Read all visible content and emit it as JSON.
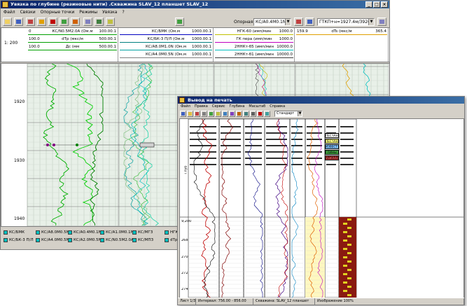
{
  "main": {
    "title": "Увязка по глубине (резиновые нити) .Скважина SLAV_12 планшет SLAV_12",
    "menu": [
      "Файл",
      "Связки",
      "Опорные точки",
      "Режимы",
      "Увязка",
      "?"
    ],
    "reference_label": "Опорная:",
    "reference_value": "КС/А0.4M0.1N",
    "right_field": "ГТКП+н=1927.4м/3920.0",
    "scale": "1: 200",
    "headers": [
      {
        "rows": [
          {
            "name": "КС/N0.5M2.0A (Ом.м",
            "min": "0",
            "max": "100.00.1",
            "color": "#00a000"
          },
          {
            "name": "dTp (мкс/м",
            "min": "100.0",
            "max": "500.00.1",
            "color": "#00a000"
          },
          {
            "name": "Дс (мм",
            "min": "100.0",
            "max": "500.00.1",
            "color": "#00a000"
          }
        ]
      },
      {
        "rows": [
          {
            "name": "КС/БМК (Ом.м",
            "min": "",
            "max": "1000.00.1",
            "color": "#0000c0"
          },
          {
            "name": "КС/БК-3 П/Л (Ом.м",
            "min": "",
            "max": "1000.00.1",
            "color": "#008080"
          },
          {
            "name": "КС/А8.0M1.0N (Ом.м",
            "min": "",
            "max": "1000.00.1",
            "color": "#00a0a0"
          },
          {
            "name": "КС/А4.0M0.5N (Ом.м",
            "min": "",
            "max": "1000.00.1",
            "color": "#808080"
          }
        ]
      },
      {
        "rows": [
          {
            "name": "НГК-60 (имп/мин",
            "min": "",
            "max": "1000.0",
            "color": "#c0c000"
          },
          {
            "name": "ГК пера (имп/мин",
            "min": "",
            "max": "1000.0",
            "color": "#c000c0"
          },
          {
            "name": "2ННКт-б5 (имп/мин",
            "min": "",
            "max": "10000.0",
            "color": "#00c0c0"
          },
          {
            "name": "2ННКт-б1 (имп/мин",
            "min": "",
            "max": "10000.0",
            "color": "#404040"
          }
        ]
      },
      {
        "rows": [
          {
            "name": "dTs (мкс/м",
            "min": "159.9",
            "max": "365.4",
            "color": "#e0a000"
          }
        ]
      }
    ],
    "depth_labels": [
      "1920",
      "1930",
      "1940"
    ],
    "marker_label": "",
    "legend": [
      {
        "label": "КС/БМК",
        "color": "#00c0c0"
      },
      {
        "label": "КС/БК-3 П/Л",
        "color": "#00c0c0"
      },
      {
        "label": "КС/А8.0M0.5N",
        "color": "#00c0c0"
      },
      {
        "label": "КС/А4.0M0.5N",
        "color": "#00c0c0"
      },
      {
        "label": "КС/А0.4M0.1N",
        "color": "#00c0c0"
      },
      {
        "label": "КС/А2.0M0.5N",
        "color": "#00c0c0"
      },
      {
        "label": "КС/А1.0M0.1N",
        "color": "#00c0c0"
      },
      {
        "label": "КС/N0.5M2.0A",
        "color": "#00c0c0"
      },
      {
        "label": "КС/МГЗ",
        "color": "#00c0c0"
      },
      {
        "label": "КС/МПЗ",
        "color": "#00c0c0"
      },
      {
        "label": "НГК-60",
        "color": "#00c0c0"
      },
      {
        "label": "dTp",
        "color": "#00c0c0"
      }
    ]
  },
  "print": {
    "title": "Вывод на печать",
    "menu": [
      "Файл",
      "Правка",
      "Сервис",
      "Глубина",
      "Масштаб",
      "Справка"
    ],
    "combo": "Стандарт",
    "depth_axis_label": "Глуб",
    "scale_label": "9,200",
    "depth_labels": [
      "268",
      "270",
      "272",
      "274"
    ],
    "lithology": [
      "ПЕСЧАНИКИ",
      "ПЕСЧАН",
      "ИЗВЕСТ",
      "ГЛИНЫ",
      "АРГИЛЛИ"
    ],
    "status": [
      "Лист 1/3",
      "Интервал: 756.00 - 856.00",
      "Скважина: SLAV_12 планшет",
      "Изображение 100%"
    ]
  }
}
